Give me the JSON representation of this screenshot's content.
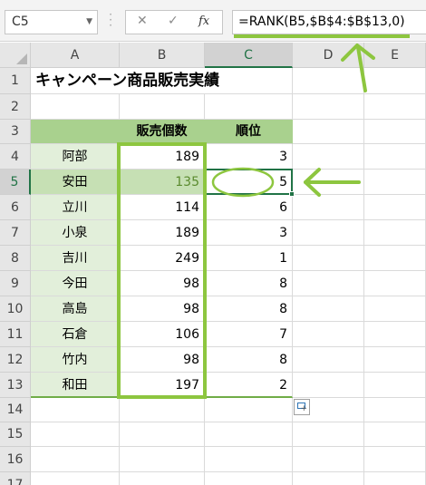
{
  "formula_bar": {
    "name_box": "C5",
    "cancel_icon": "✕",
    "enter_icon": "✓",
    "fx_label": "fx",
    "formula": "=RANK(B5,$B$4:$B$13,0)"
  },
  "columns": [
    "A",
    "B",
    "C",
    "D",
    "E"
  ],
  "rows": [
    "1",
    "2",
    "3",
    "4",
    "5",
    "6",
    "7",
    "8",
    "9",
    "10",
    "11",
    "12",
    "13",
    "14",
    "15",
    "16",
    "17"
  ],
  "sheet": {
    "title": "キャンペーン商品販売実績",
    "headers": {
      "sales": "販売個数",
      "rank": "順位"
    },
    "records": [
      {
        "name": "阿部",
        "sales": "189",
        "rank": "3"
      },
      {
        "name": "安田",
        "sales": "135",
        "rank": "5"
      },
      {
        "name": "立川",
        "sales": "114",
        "rank": "6"
      },
      {
        "name": "小泉",
        "sales": "189",
        "rank": "3"
      },
      {
        "name": "吉川",
        "sales": "249",
        "rank": "1"
      },
      {
        "name": "今田",
        "sales": "98",
        "rank": "8"
      },
      {
        "name": "高島",
        "sales": "98",
        "rank": "8"
      },
      {
        "name": "石倉",
        "sales": "106",
        "rank": "7"
      },
      {
        "name": "竹内",
        "sales": "98",
        "rank": "8"
      },
      {
        "name": "和田",
        "sales": "197",
        "rank": "2"
      }
    ]
  },
  "selected_cell": "C5",
  "colors": {
    "accent_green": "#8dc63f",
    "header_fill": "#a9d18e",
    "name_fill": "#e2efda",
    "excel_green": "#217346"
  },
  "icons": [
    "name-box-dropdown-icon",
    "cancel-icon",
    "enter-icon",
    "insert-function-icon",
    "select-all-icon",
    "quick-analysis-icon",
    "arrow-annotation"
  ]
}
